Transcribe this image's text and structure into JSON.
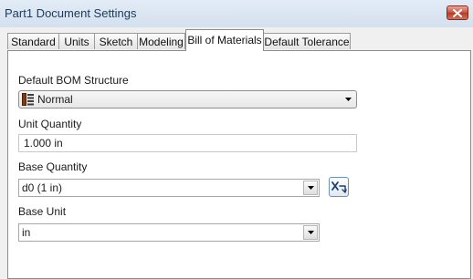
{
  "window": {
    "title": "Part1 Document Settings"
  },
  "tabs": [
    {
      "label": "Standard"
    },
    {
      "label": "Units"
    },
    {
      "label": "Sketch"
    },
    {
      "label": "Modeling"
    },
    {
      "label": "Bill of Materials"
    },
    {
      "label": "Default Tolerance"
    }
  ],
  "active_tab": "Bill of Materials",
  "bom": {
    "structure_label": "Default BOM Structure",
    "structure_value": "Normal",
    "unit_quantity_label": "Unit Quantity",
    "unit_quantity_value": "1.000 in",
    "base_quantity_label": "Base Quantity",
    "base_quantity_value": "d0 (1 in)",
    "base_unit_label": "Base Unit",
    "base_unit_value": "in"
  },
  "icons": {
    "close": "close-icon",
    "structure": "bom-structure-icon",
    "dropdown": "chevron-down-icon",
    "function": "function-icon"
  },
  "colors": {
    "title_text": "#1e395b",
    "close_button": "#c7503a",
    "panel_bg": "#ffffff",
    "dialog_bg": "#f0f0f0"
  }
}
